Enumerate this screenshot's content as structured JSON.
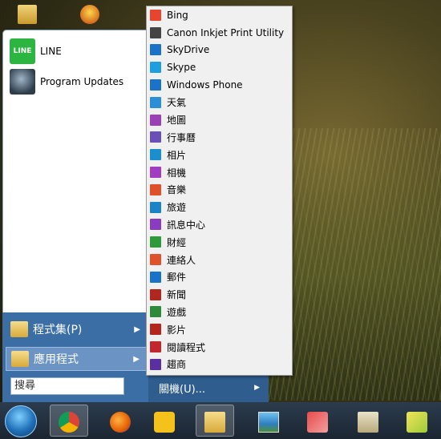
{
  "pinned": [
    {
      "label": "LINE",
      "icon": "line-icon",
      "icon_text": "LINE"
    },
    {
      "label": "Program Updates",
      "icon": "program-updates-icon"
    }
  ],
  "programs": {
    "label": "程式集(P)"
  },
  "apps": {
    "label": "應用程式"
  },
  "search": {
    "value": "搜尋"
  },
  "shutdown": {
    "label": "關機(U)..."
  },
  "apps_menu": [
    {
      "label": "Bing",
      "icon": "bing-icon",
      "color": "#e8442e"
    },
    {
      "label": "Canon Inkjet Print Utility",
      "icon": "printer-icon",
      "color": "#444444"
    },
    {
      "label": "SkyDrive",
      "icon": "cloud-icon",
      "color": "#1a73c9"
    },
    {
      "label": "Skype",
      "icon": "skype-icon",
      "color": "#1ea0e0"
    },
    {
      "label": "Windows Phone",
      "icon": "phone-icon",
      "color": "#1a73c9"
    },
    {
      "label": "天氣",
      "icon": "weather-icon",
      "color": "#2b8ed9"
    },
    {
      "label": "地圖",
      "icon": "map-icon",
      "color": "#9b3fb8"
    },
    {
      "label": "行事曆",
      "icon": "calendar-icon",
      "color": "#6a4fb8"
    },
    {
      "label": "相片",
      "icon": "photos-icon",
      "color": "#1a8fd0"
    },
    {
      "label": "相機",
      "icon": "camera-icon",
      "color": "#a23cc0"
    },
    {
      "label": "音樂",
      "icon": "music-icon",
      "color": "#e0512b"
    },
    {
      "label": "旅遊",
      "icon": "travel-icon",
      "color": "#1a84c9"
    },
    {
      "label": "訊息中心",
      "icon": "messaging-icon",
      "color": "#8a3cc0"
    },
    {
      "label": "財經",
      "icon": "finance-icon",
      "color": "#2e9a3a"
    },
    {
      "label": "連絡人",
      "icon": "people-icon",
      "color": "#e0512b"
    },
    {
      "label": "郵件",
      "icon": "mail-icon",
      "color": "#1a73c9"
    },
    {
      "label": "新聞",
      "icon": "news-icon",
      "color": "#b3261e"
    },
    {
      "label": "遊戲",
      "icon": "games-icon",
      "color": "#2e8a3a"
    },
    {
      "label": "影片",
      "icon": "video-icon",
      "color": "#b3261e"
    },
    {
      "label": "閱讀程式",
      "icon": "reader-icon",
      "color": "#c1272d"
    },
    {
      "label": "趨商",
      "icon": "store-icon",
      "color": "#5a2fa0"
    }
  ],
  "taskbar": [
    {
      "name": "chrome",
      "icon": "chrome-icon"
    },
    {
      "name": "firefox",
      "icon": "firefox-icon"
    },
    {
      "name": "app",
      "icon": "yellow-app-icon"
    },
    {
      "name": "explorer",
      "icon": "file-explorer-icon"
    },
    {
      "name": "image",
      "icon": "image-viewer-icon"
    },
    {
      "name": "eraser",
      "icon": "eraser-icon"
    },
    {
      "name": "clipboard",
      "icon": "clipboard-icon"
    },
    {
      "name": "arrow",
      "icon": "arrow-app-icon"
    }
  ]
}
